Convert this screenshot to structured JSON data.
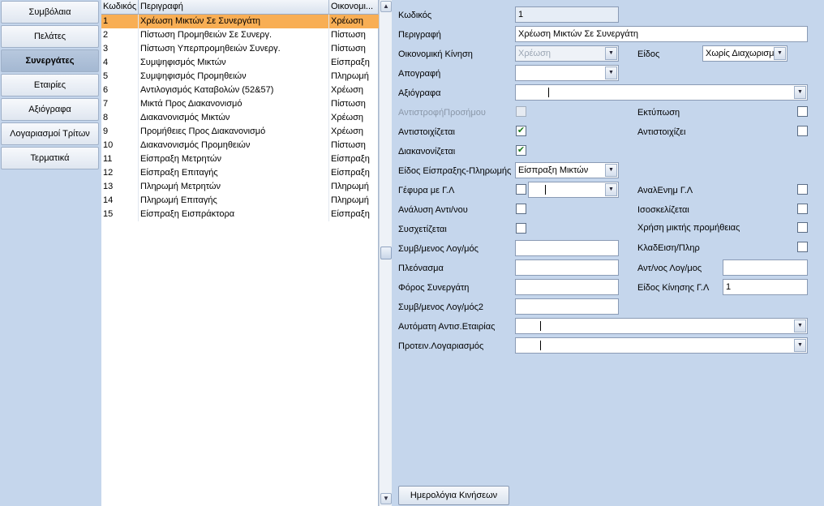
{
  "nav": {
    "items": [
      {
        "label": "Συμβόλαια"
      },
      {
        "label": "Πελάτες"
      },
      {
        "label": "Συνεργάτες"
      },
      {
        "label": "Εταιρίες"
      },
      {
        "label": "Αξιόγραφα"
      },
      {
        "label": "Λογαριασμοί Τρίτων"
      },
      {
        "label": "Τερματικά"
      }
    ],
    "active": "Συνεργάτες"
  },
  "grid": {
    "headers": [
      "Κωδικός",
      "Περιγραφή",
      "Οικονομι..."
    ],
    "rows": [
      [
        "1",
        "Χρέωση Μικτών Σε Συνεργάτη",
        "Χρέωση"
      ],
      [
        "2",
        "Πίστωση Προμηθειών Σε Συνεργ.",
        "Πίστωση"
      ],
      [
        "3",
        "Πίστωση Υπερπρομηθειών Συνεργ.",
        "Πίστωση"
      ],
      [
        "4",
        "Συμψηφισμός Μικτών",
        "Είσπραξη"
      ],
      [
        "5",
        "Συμψηφισμός Προμηθειών",
        "Πληρωμή"
      ],
      [
        "6",
        "Αντιλογισμός Καταβολών (52&57)",
        "Χρέωση"
      ],
      [
        "7",
        "Μικτά Προς Διακανονισμό",
        "Πίστωση"
      ],
      [
        "8",
        "Διακανονισμός Μικτών",
        "Χρέωση"
      ],
      [
        "9",
        "Προμήθειες Προς Διακανονισμό",
        "Χρέωση"
      ],
      [
        "10",
        "Διακανονισμός Προμηθειών",
        "Πίστωση"
      ],
      [
        "11",
        "Είσπραξη Μετρητών",
        "Είσπραξη"
      ],
      [
        "12",
        "Είσπραξη Επιταγής",
        "Είσπραξη"
      ],
      [
        "13",
        "Πληρωμή Μετρητών",
        "Πληρωμή"
      ],
      [
        "14",
        "Πληρωμή Επιταγής",
        "Πληρωμή"
      ],
      [
        "15",
        "Είσπραξη Εισπράκτορα",
        "Είσπραξη"
      ]
    ],
    "selected_row": 0
  },
  "form": {
    "code": {
      "label": "Κωδικός",
      "value": "1"
    },
    "description": {
      "label": "Περιγραφή",
      "value": "Χρέωση Μικτών Σε Συνεργάτη"
    },
    "financial_move": {
      "label": "Οικονομική Κίνηση",
      "value": "Χρέωση"
    },
    "kind": {
      "label": "Είδος",
      "value": "Χωρίς Διαχωρισμό"
    },
    "inventory": {
      "label": "Απογραφή",
      "value": ""
    },
    "securities": {
      "label": "Αξιόγραφα",
      "value": ""
    },
    "sign_reverse": {
      "label": "ΑντιστροφήΠροσήμου",
      "checked": false
    },
    "print": {
      "label": "Εκτύπωση",
      "checked": false
    },
    "matched": {
      "label": "Αντιστοιχίζεται",
      "checked": true
    },
    "matches": {
      "label": "Αντιστοιχίζει",
      "checked": false
    },
    "settled": {
      "label": "Διακανονίζεται",
      "checked": true
    },
    "collection_type": {
      "label": "Είδος Είσπραξης-Πληρωμής",
      "value": "Είσπραξη Μικτών"
    },
    "gl_bridge": {
      "label": "Γέφυρα με Γ.Λ",
      "checked": false,
      "value": ""
    },
    "gl_analysis": {
      "label": "ΑναλΕνημ Γ.Λ",
      "checked": false
    },
    "counter_analysis": {
      "label": "Ανάλυση Αντι/νου",
      "checked": false
    },
    "balanced": {
      "label": "Ισοσκελίζεται",
      "checked": false
    },
    "correlated": {
      "label": "Συσχετίζεται",
      "checked": false
    },
    "mixed_commission": {
      "label": "Χρήση μικτής προμήθειας",
      "checked": false
    },
    "contracted_account": {
      "label": "Συμβ/μενος Λογ/μός",
      "value": ""
    },
    "branch_pay": {
      "label": "ΚλαδΕιση/Πληρ",
      "checked": false
    },
    "surplus": {
      "label": "Πλεόνασμα",
      "value": ""
    },
    "counter_account": {
      "label": "Αντ/νος Λογ/μος",
      "value": ""
    },
    "partner_tax": {
      "label": "Φόρος Συνεργάτη",
      "value": ""
    },
    "gl_move_type": {
      "label": "Είδος Κίνησης Γ.Λ",
      "value": "1"
    },
    "contracted_account2": {
      "label": "Συμβ/μενος Λογ/μός2",
      "value": ""
    },
    "auto_company_match": {
      "label": "Αυτόματη Αντισ.Εταιρίας",
      "value": ""
    },
    "suggested_accounts": {
      "label": "Προτειν.Λογαριασμός",
      "value": ""
    },
    "journals_button": "Ημερολόγια Κινήσεων"
  },
  "colors": {
    "background": "#c5d6ec",
    "selected_row": "#f8ae54",
    "check": "#1f7a1f"
  }
}
